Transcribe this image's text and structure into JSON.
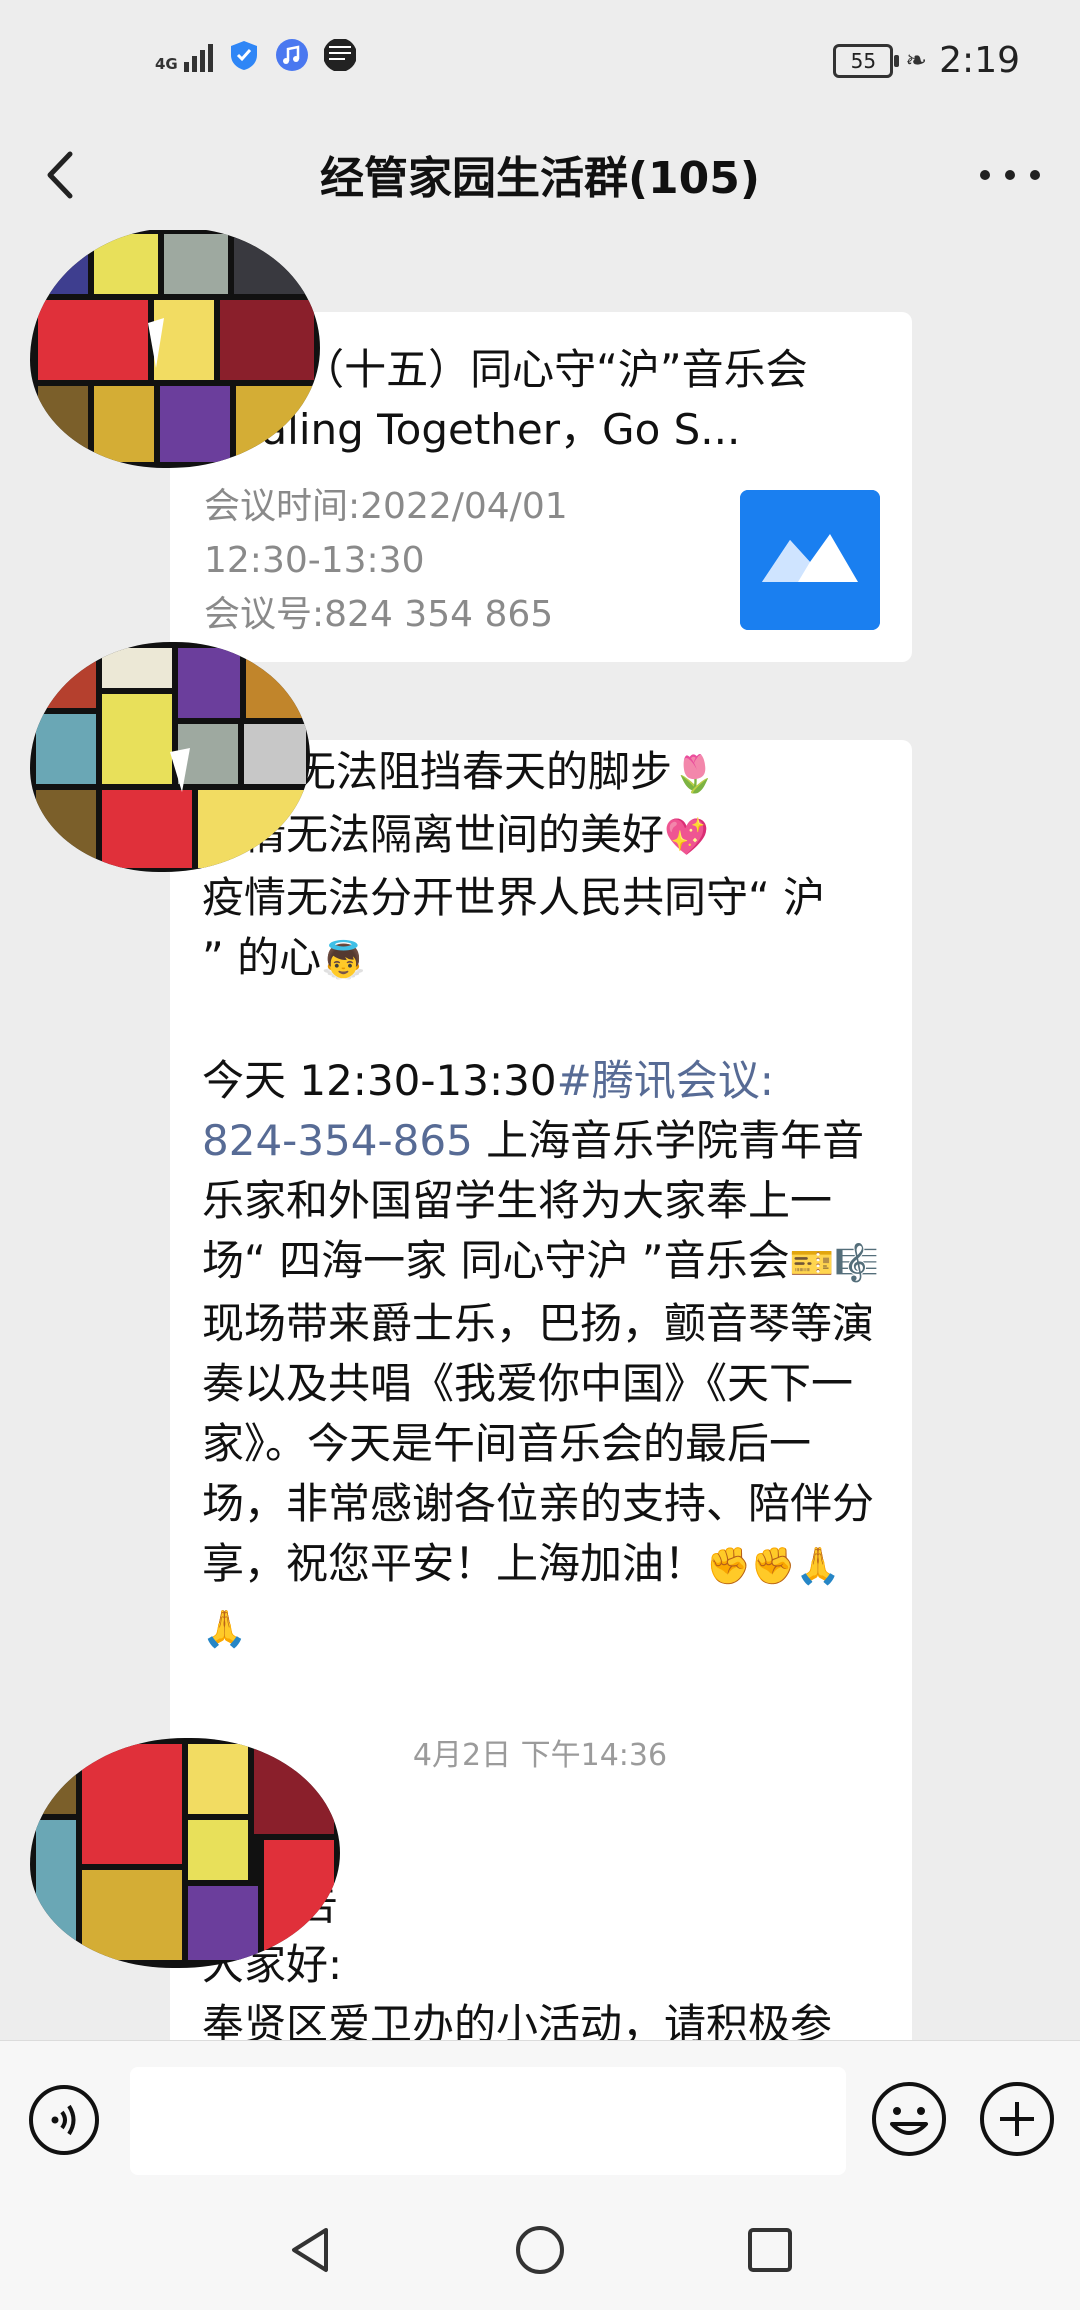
{
  "status_bar": {
    "network_type": "4G",
    "battery_level": "55",
    "time": "2:19"
  },
  "header": {
    "title": "经管家园生活群(105)"
  },
  "messages": {
    "meeting_card": {
      "title": "邀请:（十五）同心守“沪”音乐会 Healing Together，Go S...",
      "meeting_time": "会议时间:2022/04/01",
      "meeting_span": "12:30-13:30",
      "meeting_id": "会议号:824 354 865"
    },
    "poem": {
      "line1": "无法阻挡春天的脚步",
      "line2": "疫情无法隔离世间的美好",
      "line3": "疫情无法分开世界人民共同守“ 沪",
      "line4": "” 的心",
      "p2_intro": "今天 12:30-13:30",
      "p2_link": "#腾讯会议: 824-354-865",
      "p2_body1": " 上海音乐学院青年音乐家和外国留学生将为大家奉上一场“ 四海一家 同心守沪 ”音乐会",
      "p2_body2": "现场带来爵士乐，巴扬，颤音琴等演奏以及共唱《我爱你中国》《天下一家》。今天是午间音乐会的最后一场，非常感谢各位亲的支持、陪伴分享，祝您平安！上海加油！"
    },
    "timestamp": "4月2日 下午14:36",
    "notice": {
      "line1": "公告",
      "line2": "大家好:",
      "line3": "奉贤区爱卫办的小活动，请积极参"
    }
  },
  "emoji": {
    "tulip": "🌷",
    "heart": "💖",
    "angel": "👼",
    "ticket": "🎫",
    "music": "🎼",
    "fists": "✊✊🙏🙏"
  },
  "colors": {
    "background": "#ededed",
    "bubble": "#ffffff",
    "link": "#576b95",
    "meeting_logo": "#1a7ff0",
    "meta_text": "#8a8a8a"
  },
  "icons": {
    "back": "chevron-left-icon",
    "more": "more-icon",
    "voice": "voice-icon",
    "emoji": "emoji-icon",
    "plus": "plus-icon",
    "nav_back": "triangle-back-icon",
    "nav_home": "circle-home-icon",
    "nav_recent": "square-recent-icon"
  }
}
